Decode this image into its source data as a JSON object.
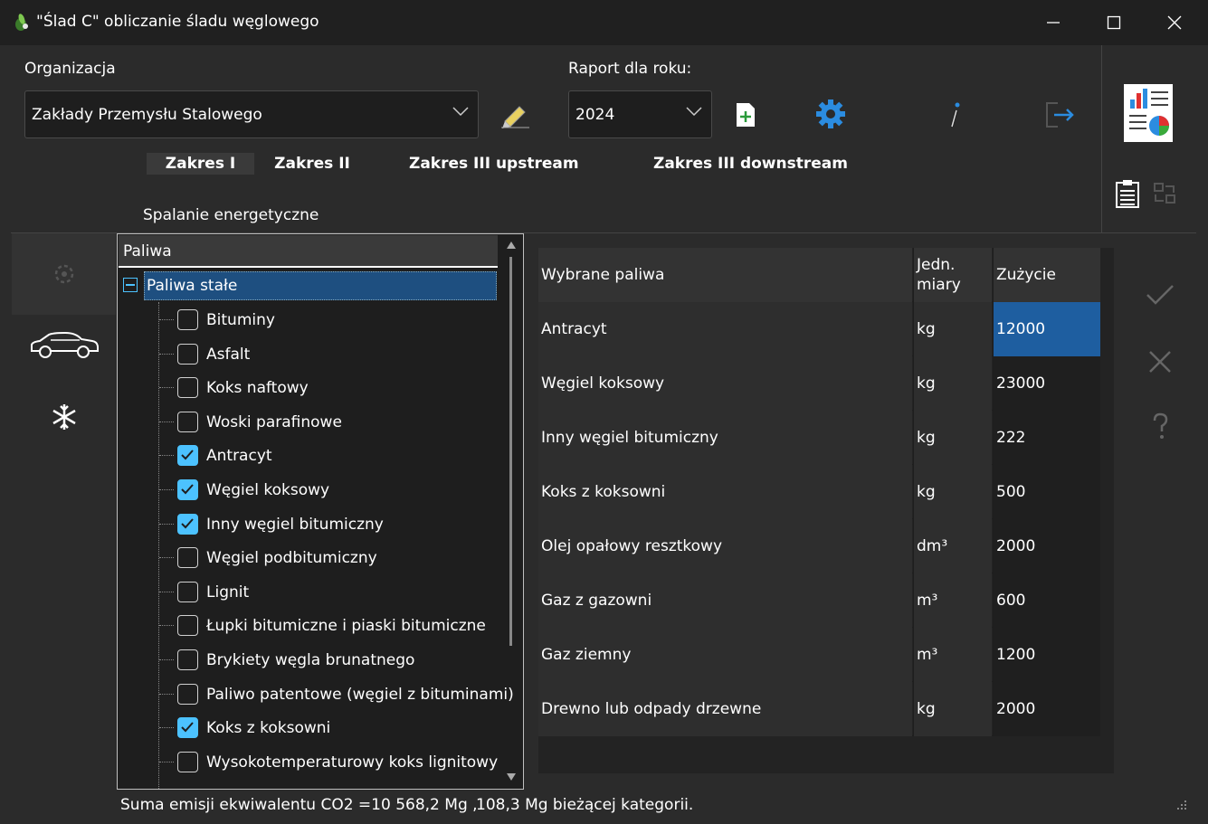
{
  "window": {
    "title": "\"Ślad C\" obliczanie śladu węglowego"
  },
  "organization": {
    "label": "Organizacja",
    "value": "Zakłady Przemysłu Stalowego"
  },
  "report": {
    "label": "Raport dla roku:",
    "year": "2024"
  },
  "tabs": [
    {
      "label": "Zakres I",
      "selected": true
    },
    {
      "label": "Zakres  II",
      "selected": false
    },
    {
      "label": "Zakres III upstream",
      "selected": false
    },
    {
      "label": "Zakres III downstream",
      "selected": false
    }
  ],
  "section_title": "Spalanie energetyczne",
  "tree": {
    "header": "Paliwa",
    "group": "Paliwa stałe",
    "items": [
      {
        "label": "Bituminy",
        "checked": false
      },
      {
        "label": "Asfalt",
        "checked": false
      },
      {
        "label": "Koks naftowy",
        "checked": false
      },
      {
        "label": "Woski parafinowe",
        "checked": false
      },
      {
        "label": "Antracyt",
        "checked": true
      },
      {
        "label": "Węgiel koksowy",
        "checked": true
      },
      {
        "label": "Inny węgiel bitumiczny",
        "checked": true
      },
      {
        "label": "Węgiel podbitumiczny",
        "checked": false
      },
      {
        "label": "Lignit",
        "checked": false
      },
      {
        "label": "Łupki bitumiczne i piaski bitumiczne",
        "checked": false
      },
      {
        "label": "Brykiety węgla brunatnego",
        "checked": false
      },
      {
        "label": "Paliwo patentowe (węgiel z bituminami)",
        "checked": false
      },
      {
        "label": "Koks z koksowni",
        "checked": true
      },
      {
        "label": "Wysokotemperaturowy koks lignitowy",
        "checked": false
      }
    ]
  },
  "table": {
    "headers": [
      "Wybrane paliwa",
      "Jedn.\nmiary",
      "Zużycie"
    ],
    "rows": [
      {
        "fuel": "Antracyt",
        "unit": "kg",
        "usage": "12000",
        "selected": true
      },
      {
        "fuel": "Węgiel koksowy",
        "unit": "kg",
        "usage": "23000"
      },
      {
        "fuel": "Inny węgiel bitumiczny",
        "unit": "kg",
        "usage": "222"
      },
      {
        "fuel": "Koks z koksowni",
        "unit": "kg",
        "usage": "500"
      },
      {
        "fuel": "Olej opałowy resztkowy",
        "unit": "dm³",
        "usage": "2000"
      },
      {
        "fuel": "Gaz z gazowni",
        "unit": "m³",
        "usage": "600"
      },
      {
        "fuel": "Gaz ziemny",
        "unit": "m³",
        "usage": "1200"
      },
      {
        "fuel": "Drewno lub odpady drzewne",
        "unit": "kg",
        "usage": "2000"
      }
    ]
  },
  "status": {
    "total": "Suma emisji ekwiwalentu CO2 =10 568,2 Mg ,",
    "category": "108,3 Mg bieżącej kategorii."
  },
  "colors": {
    "accent": "#4cc2ff",
    "selection": "#1e5ea0",
    "gear": "#2b8ce0"
  }
}
